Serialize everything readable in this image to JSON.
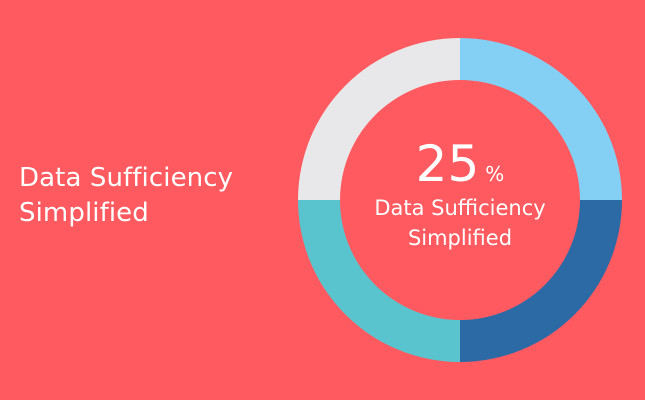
{
  "title_line1": "Data Sufficiency",
  "title_line2": "Simplified",
  "center": {
    "value": "25",
    "unit": "%",
    "label_line1": "Data Sufficiency",
    "label_line2": "Simplified"
  },
  "colors": {
    "background": "#FF5A5F",
    "text": "#FFFFFF"
  },
  "chart_data": {
    "type": "pie",
    "style": "donut",
    "title": "",
    "center_value": 25,
    "center_unit": "%",
    "slices": [
      {
        "value": 25,
        "color": "#84CFF4"
      },
      {
        "value": 25,
        "color": "#2C6AA6"
      },
      {
        "value": 25,
        "color": "#59C4CE"
      },
      {
        "value": 25,
        "color": "#E8E8EA"
      }
    ],
    "start_angle_deg": 0,
    "direction": "clockwise"
  }
}
